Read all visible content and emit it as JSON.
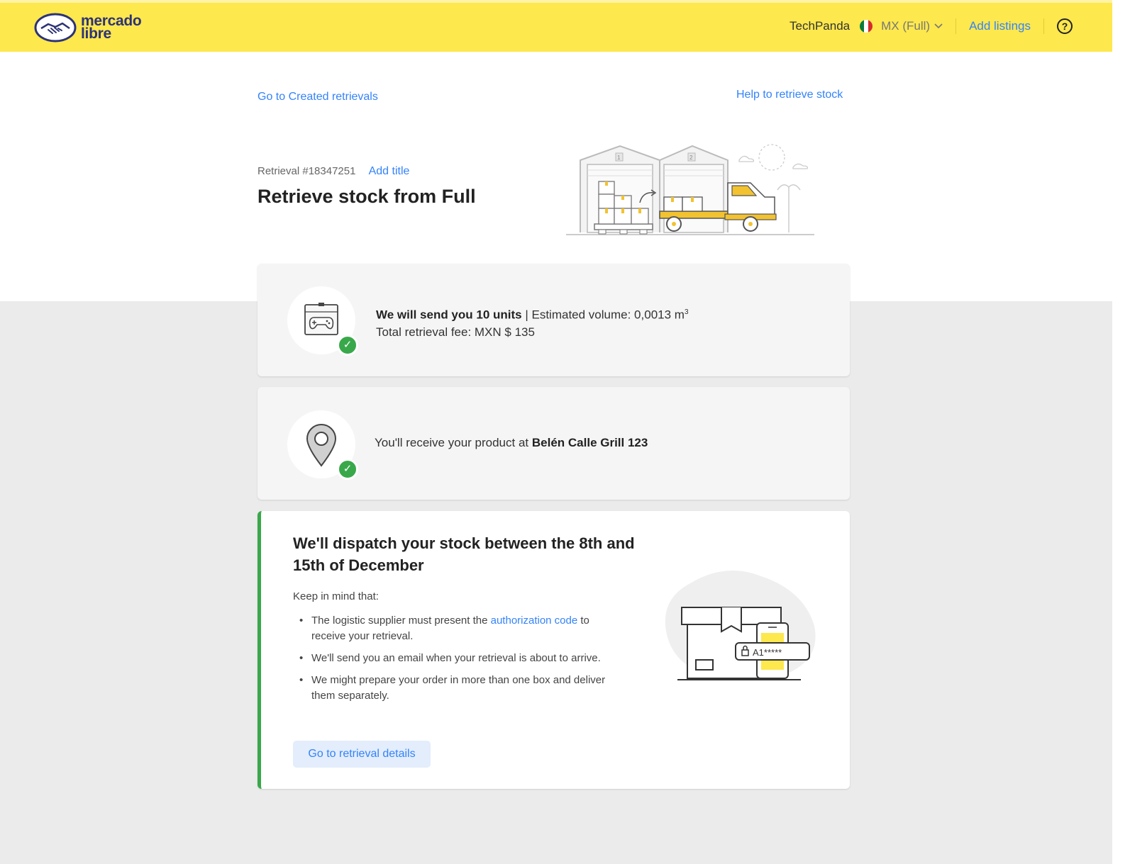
{
  "header": {
    "logo_line1": "mercado",
    "logo_line2": "libre",
    "user": "TechPanda",
    "site": "MX (Full)",
    "add_listings": "Add listings",
    "help": "?"
  },
  "nav": {
    "created_retrievals": "Go to Created retrievals",
    "help_retrieve": "Help to retrieve stock"
  },
  "retrieval": {
    "number": "Retrieval #18347251",
    "add_title": "Add title",
    "title": "Retrieve stock from Full"
  },
  "hero": {
    "dock1": "1",
    "dock2": "2"
  },
  "units_card": {
    "bold": "We will send you 10 units",
    "volume": "| Estimated volume: 0,0013 m",
    "volume_sup": "3",
    "fee": "Total retrieval fee: MXN $ 135"
  },
  "address_card": {
    "text": "You'll receive your product at",
    "address": "Belén Calle Grill 123"
  },
  "dispatch_card": {
    "title": "We'll dispatch your stock between the 8th and 15th  of December",
    "keep_in_mind": "Keep in mind that:",
    "b1_pre": "The logistic supplier must present the",
    "b1_link": "authorization code",
    "b1_post": "to receive your retrieval.",
    "b2": "We'll send you an email when your retrieval is about to arrive.",
    "b3": "We might prepare your order in more than one box and deliver them separately.",
    "code": "A1*****",
    "button": "Go to retrieval details"
  },
  "colors": {
    "brand_yellow": "#fde84d",
    "link_blue": "#3483fa",
    "success_green": "#39a84a",
    "logo_navy": "#2d3277"
  },
  "icons": [
    "handshake-logo-icon",
    "mexico-flag-icon",
    "chevron-down-icon",
    "help-icon",
    "gamepad-icon",
    "location-pin-icon",
    "check-icon",
    "warehouse-truck-illustration",
    "box-phone-illustration",
    "padlock-icon"
  ]
}
